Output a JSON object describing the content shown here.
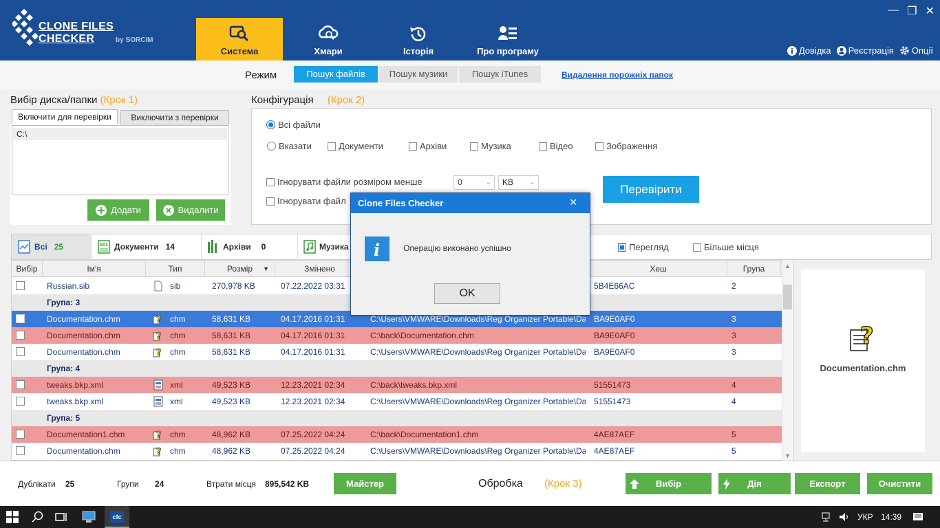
{
  "app": {
    "logo_title": "CLONE FILES CHECKER",
    "logo_sub": "by SORCIM"
  },
  "nav": [
    {
      "label": "Система",
      "icon": "search-monitor-icon"
    },
    {
      "label": "Хмари",
      "icon": "cloud-search-icon"
    },
    {
      "label": "Історія",
      "icon": "history-icon"
    },
    {
      "label": "Про програму",
      "icon": "about-icon"
    }
  ],
  "top_links": {
    "help": "Довідка",
    "register": "Реєстрація",
    "options": "Опції"
  },
  "mode": {
    "label": "Режим",
    "buttons": [
      "Пошук файлів",
      "Пошук музики",
      "Пошук iTunes"
    ],
    "link": "Видалення порожніх папок"
  },
  "step1": {
    "title": "Вибір диска/папки",
    "step": "(Крок 1)",
    "tab_include": "Включити для перевірки",
    "tab_exclude": "Виключити з перевірки",
    "path": "C:\\",
    "add": "Додати",
    "remove": "Видалити"
  },
  "step2": {
    "title": "Конфігурація",
    "step": "(Крок 2)",
    "all_files": "Всі файли",
    "specify": "Вказати",
    "types": [
      "Документи",
      "Архіви",
      "Музика",
      "Відео",
      "Зображення"
    ],
    "ignore_size": "Ігнорувати файли розміром менше",
    "ignore_other": "Ігнорувати файл",
    "size_value": "0",
    "size_unit": "KB",
    "check_btn": "Перевірити"
  },
  "filters": {
    "tabs": [
      {
        "label": "Всі",
        "count": "25"
      },
      {
        "label": "Документи",
        "count": "14"
      },
      {
        "label": "Архіви",
        "count": "0"
      },
      {
        "label": "Музика",
        "count": ""
      }
    ],
    "preview": "Перегляд",
    "more_space": "Більше місця"
  },
  "grid": {
    "headers": [
      "Вибір",
      "Ім'я",
      "Тип",
      "Розмір",
      "Змінено",
      "Хеш",
      "Група"
    ],
    "rows": [
      {
        "kind": "white",
        "name": "Russian.sib",
        "type": "sib",
        "size": "270,978 KB",
        "date": "07.22.2022 03:31",
        "path": "",
        "hash": "5B4E66AC",
        "group": "2"
      },
      {
        "kind": "grp",
        "name": "Група: 3"
      },
      {
        "kind": "sel",
        "name": "Documentation.chm",
        "type": "chm",
        "size": "58,631 KB",
        "date": "04.17.2016 01:31",
        "path": "C:\\Users\\VMWARE\\Downloads\\Reg Organizer Portable\\Dat",
        "hash": "BA9E0AF0",
        "group": "3"
      },
      {
        "kind": "red",
        "name": "Documentation.chm",
        "type": "chm",
        "size": "58,631 KB",
        "date": "04.17.2016 01:31",
        "path": "C:\\back\\Documentation.chm",
        "hash": "BA9E0AF0",
        "group": "3"
      },
      {
        "kind": "white",
        "name": "Documentation.chm",
        "type": "chm",
        "size": "58,631 KB",
        "date": "04.17.2016 01:31",
        "path": "C:\\Users\\VMWARE\\Downloads\\Reg Organizer Portable\\Dat",
        "hash": "BA9E0AF0",
        "group": "3"
      },
      {
        "kind": "grp",
        "name": "Група: 4"
      },
      {
        "kind": "red",
        "name": "tweaks.bkp.xml",
        "type": "xml",
        "size": "49,523 KB",
        "date": "12.23.2021 02:34",
        "path": "C:\\back\\tweaks.bkp.xml",
        "hash": "51551473",
        "group": "4"
      },
      {
        "kind": "white",
        "name": "tweaks.bkp.xml",
        "type": "xml",
        "size": "49,523 KB",
        "date": "12.23.2021 02:34",
        "path": "C:\\Users\\VMWARE\\Downloads\\Reg Organizer Portable\\Dat",
        "hash": "51551473",
        "group": "4"
      },
      {
        "kind": "grp",
        "name": "Група: 5"
      },
      {
        "kind": "red",
        "name": "Documentation1.chm",
        "type": "chm",
        "size": "48,962 KB",
        "date": "07.25.2022 04:24",
        "path": "C:\\back\\Documentation1.chm",
        "hash": "4AE87AEF",
        "group": "5"
      },
      {
        "kind": "white",
        "name": "Documentation.chm",
        "type": "chm",
        "size": "48,962 KB",
        "date": "07.25.2022 04:24",
        "path": "C:\\Users\\VMWARE\\Downloads\\Reg Organizer Portable\\Dat",
        "hash": "4AE87AEF",
        "group": "5"
      }
    ]
  },
  "preview_file": "Documentation.chm",
  "status": {
    "dupes_label": "Дублікати",
    "dupes": "25",
    "groups_label": "Групи",
    "groups": "24",
    "waste_label": "Втрати місця",
    "waste": "895,542 KB",
    "wizard": "Майстер",
    "process": "Обробка",
    "step3": "(Крок 3)",
    "select": "Вибір",
    "action": "Дія",
    "export": "Експорт",
    "clean": "Очистити"
  },
  "dialog": {
    "title": "Clone Files Checker",
    "message": "Операцію виконано успішно",
    "ok": "OK"
  },
  "taskbar": {
    "lang": "УКР",
    "time": "14:39",
    "app": "cfc"
  }
}
